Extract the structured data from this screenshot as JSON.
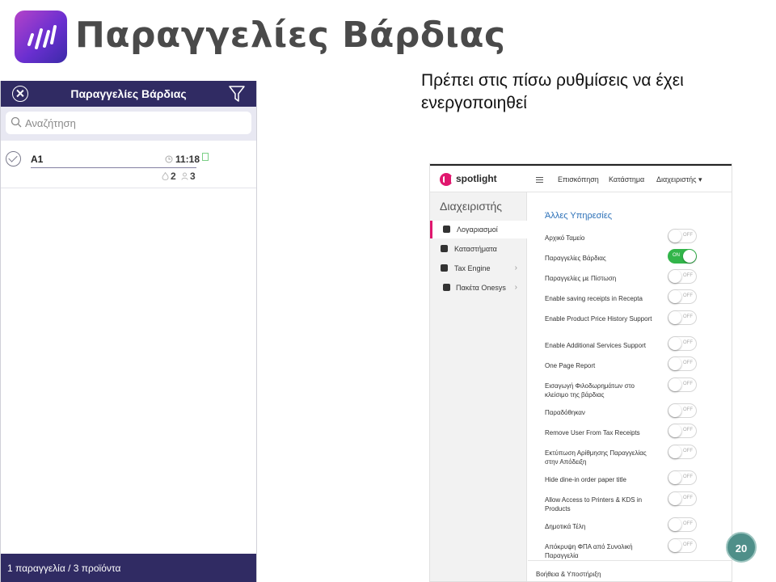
{
  "slide": {
    "title": "Παραγγελίες Βάρδιας",
    "note": "Πρέπει στις πίσω ρυθμίσεις να έχει ενεργοποιηθεί",
    "page_number": "20",
    "logo_icon": "bars-logo-icon"
  },
  "phone": {
    "header_title": "Παραγγελίες Βάρδιας",
    "search_placeholder": "Αναζήτηση",
    "order": {
      "name": "A1",
      "time": "11:18",
      "count_a": "2",
      "count_b": "3"
    },
    "footer": "1 παραγγελία / 3 προϊόντα",
    "colors": {
      "header": "#302b63"
    }
  },
  "admin": {
    "brand": "spotlight",
    "nav": [
      "Επισκόπηση",
      "Κατάστημα",
      "Διαχειριστής ▾"
    ],
    "sidebar_title": "Διαχειριστής",
    "sidebar_items": [
      {
        "label": "Λογαριασμοί",
        "chevron": ""
      },
      {
        "label": "Καταστήματα",
        "chevron": ""
      },
      {
        "label": "Tax Engine",
        "chevron": "›"
      },
      {
        "label": "Πακέτα Onesys",
        "chevron": "›"
      }
    ],
    "section_title": "Άλλες Υπηρεσίες",
    "settings": [
      {
        "label": "Αρχικό Ταμείο",
        "state": "OFF"
      },
      {
        "label": "Παραγγελίες Βάρδιας",
        "state": "ON"
      },
      {
        "label": "Παραγγελίες με Πίστωση",
        "state": "OFF"
      },
      {
        "label": "Enable saving receipts in Recepta",
        "state": "OFF"
      },
      {
        "label": "Enable Product Price History Support",
        "state": "OFF"
      },
      {
        "label": "Enable Additional Services Support",
        "state": "OFF"
      },
      {
        "label": "One Page Report",
        "state": "OFF"
      },
      {
        "label": "Εισαγωγή Φιλοδωρημάτων στο κλείσιμο της βάρδιας",
        "state": "OFF"
      },
      {
        "label": "Παραδόθηκαν",
        "state": "OFF"
      },
      {
        "label": "Remove User From Tax Receipts",
        "state": "OFF"
      },
      {
        "label": "Εκτύπωση Αρίθμησης Παραγγελίας στην Απόδειξη",
        "state": "OFF"
      },
      {
        "label": "Hide dine-in order paper title",
        "state": "OFF"
      },
      {
        "label": "Allow Access to Printers & KDS in Products",
        "state": "OFF"
      },
      {
        "label": "Δημοτικά Τέλη",
        "state": "OFF"
      },
      {
        "label": "Απόκρυψη ΦΠΑ από Συνολική Παραγγελία",
        "state": "OFF"
      }
    ],
    "footer": "Βοήθεια & Υποστήριξη",
    "colors": {
      "accent": "#e0176e",
      "toggle_on": "#32b54a",
      "section": "#2a6fb7"
    }
  }
}
